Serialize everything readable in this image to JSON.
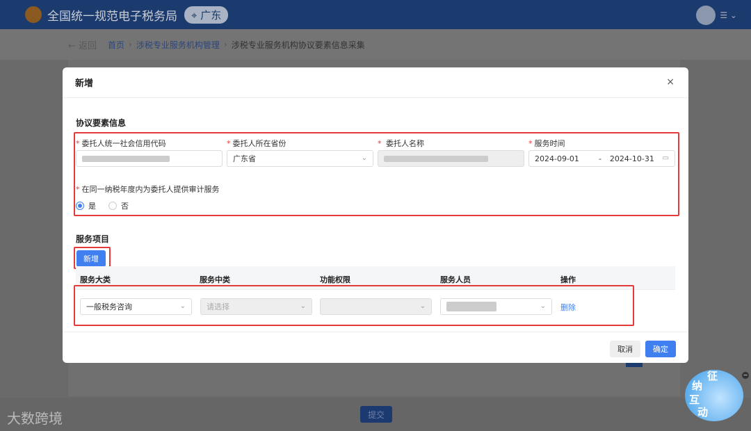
{
  "header": {
    "title": "全国统一规范电子税务局",
    "region": "广东"
  },
  "breadcrumb": {
    "back": "← 返回",
    "items": [
      "首页",
      "涉税专业服务机构管理",
      "涉税专业服务机构协议要素信息采集"
    ]
  },
  "footer": {
    "submit": "提交",
    "watermark": "大数跨境"
  },
  "modal": {
    "title": "新增",
    "close": "×",
    "section1": "协议要素信息",
    "fields": {
      "credit_code_label": "委托人统一社会信用代码",
      "province_label": "委托人所在省份",
      "province_value": "广东省",
      "name_label": "委托人名称",
      "service_time_label": "服务时间",
      "start_date": "2024-09-01",
      "date_sep": "-",
      "end_date": "2024-10-31",
      "audit_label": "在同一纳税年度内为委托人提供审计服务",
      "audit_options": [
        "是",
        "否"
      ]
    },
    "section2": "服务项目",
    "add_button": "新增",
    "table": {
      "headers": [
        "服务大类",
        "服务中类",
        "功能权限",
        "服务人员",
        "操作"
      ],
      "row": {
        "category": "一般税务咨询",
        "subcategory_placeholder": "请选择",
        "action": "删除"
      }
    },
    "cancel": "取消",
    "confirm": "确定"
  },
  "mascot": {
    "text": [
      "征",
      "纳",
      "互",
      "动"
    ]
  }
}
